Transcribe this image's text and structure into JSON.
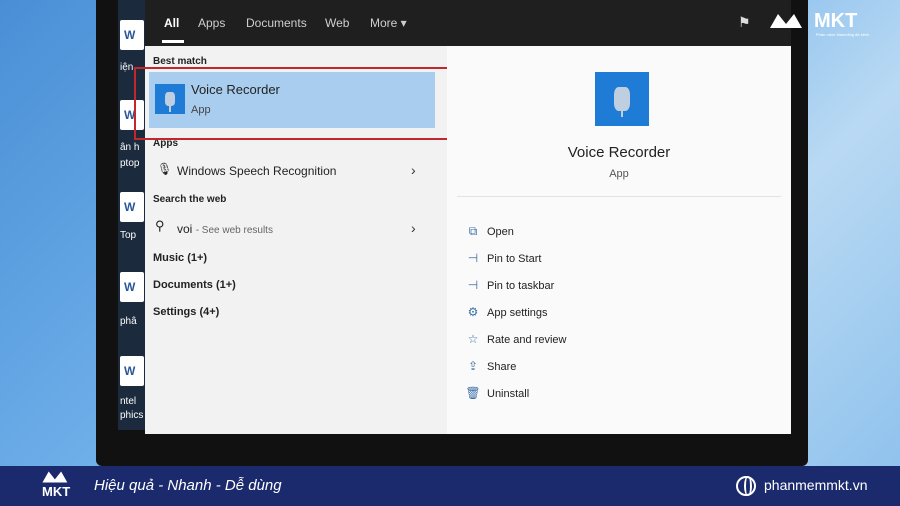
{
  "tabs": [
    {
      "label": "All"
    },
    {
      "label": "Apps"
    },
    {
      "label": "Documents"
    },
    {
      "label": "Web"
    },
    {
      "label": "More ▾"
    }
  ],
  "best_match": {
    "heading": "Best match",
    "title": "Voice Recorder",
    "subtitle": "App"
  },
  "apps": {
    "heading": "Apps",
    "item": "Windows Speech Recognition"
  },
  "web": {
    "heading": "Search the web",
    "query": "voi",
    "hint": "- See web results"
  },
  "categories": [
    {
      "label": "Music (1+)"
    },
    {
      "label": "Documents (1+)"
    },
    {
      "label": "Settings (4+)"
    }
  ],
  "detail": {
    "title": "Voice Recorder",
    "subtitle": "App"
  },
  "actions": [
    {
      "label": "Open",
      "icon": "open-icon"
    },
    {
      "label": "Pin to Start",
      "icon": "pin-icon"
    },
    {
      "label": "Pin to taskbar",
      "icon": "pin-icon"
    },
    {
      "label": "App settings",
      "icon": "gear-icon"
    },
    {
      "label": "Rate and review",
      "icon": "star-icon"
    },
    {
      "label": "Share",
      "icon": "share-icon"
    },
    {
      "label": "Uninstall",
      "icon": "trash-icon"
    }
  ],
  "desktop_labels": [
    "iện",
    "ân h",
    "ptop",
    "Top",
    "phâ",
    "ntel",
    "phics"
  ],
  "brand": {
    "logo": "MKT",
    "logo_sub": "Phần mềm Marketing đa kênh"
  },
  "footer": {
    "tagline": "Hiệu quả - Nhanh - Dễ dùng",
    "website": "phanmemmkt.vn"
  },
  "colors": {
    "accent": "#1e7bd6",
    "highlight": "#a9cdef",
    "frame": "#c0282d",
    "footer": "#1b2a6d"
  }
}
